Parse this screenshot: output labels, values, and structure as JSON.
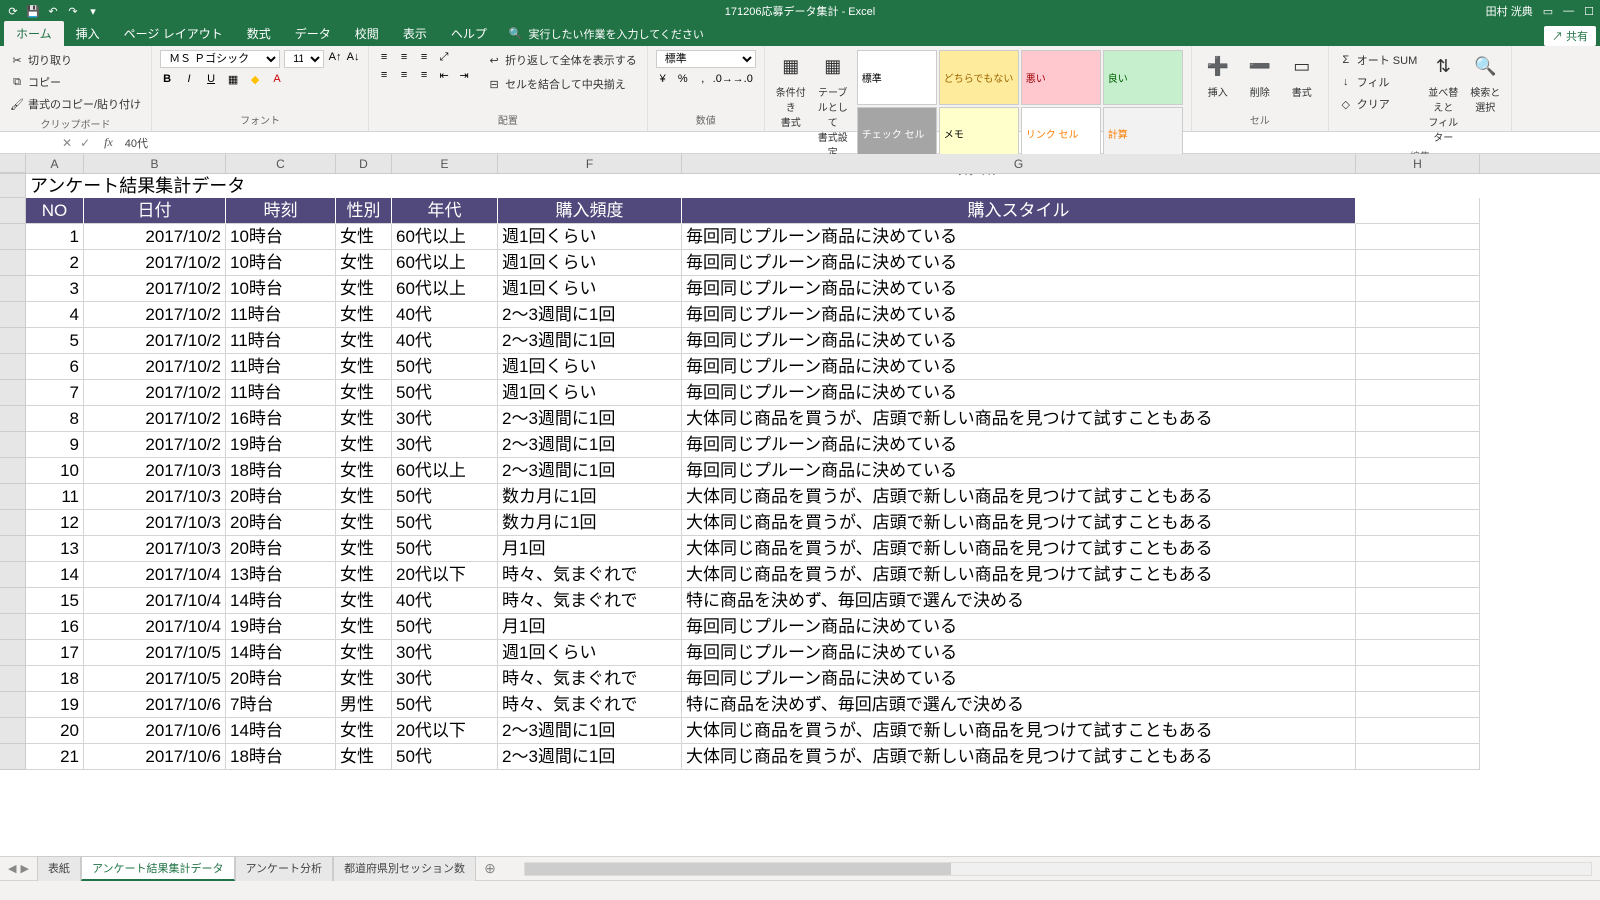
{
  "title": "171206応募データ集計 - Excel",
  "user": "田村 洸典",
  "qat": [
    "autosave",
    "save",
    "undo",
    "redo",
    "touch"
  ],
  "tabs": [
    "ホーム",
    "挿入",
    "ページ レイアウト",
    "数式",
    "データ",
    "校閲",
    "表示",
    "ヘルプ"
  ],
  "active_tab": 0,
  "tell_me": "実行したい作業を入力してください",
  "share": "共有",
  "ribbon": {
    "clipboard": {
      "cut": "切り取り",
      "copy": "コピー",
      "paste": "書式のコピー/貼り付け",
      "label": "クリップボード"
    },
    "font": {
      "name": "ＭＳ Ｐゴシック",
      "size": "11",
      "label": "フォント"
    },
    "align": {
      "wrap": "折り返して全体を表示する",
      "merge": "セルを結合して中央揃え",
      "label": "配置"
    },
    "number": {
      "format": "標準",
      "label": "数値"
    },
    "styles": {
      "cond": "条件付き\n書式",
      "table": "テーブルとして\n書式設定",
      "cells": [
        {
          "t": "標準",
          "bg": "#ffffff",
          "c": "#000"
        },
        {
          "t": "どちらでもない",
          "bg": "#ffeb9c",
          "c": "#9c6500"
        },
        {
          "t": "悪い",
          "bg": "#ffc7ce",
          "c": "#9c0006"
        },
        {
          "t": "良い",
          "bg": "#c6efce",
          "c": "#006100"
        },
        {
          "t": "チェック セル",
          "bg": "#a5a5a5",
          "c": "#fff"
        },
        {
          "t": "メモ",
          "bg": "#ffffcc",
          "c": "#000"
        },
        {
          "t": "リンク セル",
          "bg": "#ffffff",
          "c": "#ff8001"
        },
        {
          "t": "計算",
          "bg": "#f2f2f2",
          "c": "#fa7d00"
        }
      ],
      "label": "スタイル"
    },
    "cells": {
      "insert": "挿入",
      "delete": "削除",
      "format": "書式",
      "label": "セル"
    },
    "editing": {
      "sum": "オート SUM",
      "fill": "フィル",
      "clear": "クリア",
      "sort": "並べ替えと\nフィルター",
      "find": "検索と\n選択",
      "label": "編集"
    }
  },
  "name_box": "",
  "formula": "40代",
  "cols": [
    "A",
    "B",
    "C",
    "D",
    "E",
    "F",
    "G",
    "H"
  ],
  "sheet_title": "アンケート結果集計データ",
  "headers": [
    "NO",
    "日付",
    "時刻",
    "性別",
    "年代",
    "購入頻度",
    "購入スタイル"
  ],
  "rows": [
    {
      "n": 1,
      "d": [
        1,
        "2017/10/2",
        "10時台",
        "女性",
        "60代以上",
        "週1回くらい",
        "毎回同じプルーン商品に決めている"
      ]
    },
    {
      "n": 2,
      "d": [
        2,
        "2017/10/2",
        "10時台",
        "女性",
        "60代以上",
        "週1回くらい",
        "毎回同じプルーン商品に決めている"
      ]
    },
    {
      "n": 3,
      "d": [
        3,
        "2017/10/2",
        "10時台",
        "女性",
        "60代以上",
        "週1回くらい",
        "毎回同じプルーン商品に決めている"
      ]
    },
    {
      "n": 4,
      "d": [
        4,
        "2017/10/2",
        "11時台",
        "女性",
        "40代",
        "2～3週間に1回",
        "毎回同じプルーン商品に決めている"
      ]
    },
    {
      "n": 5,
      "d": [
        5,
        "2017/10/2",
        "11時台",
        "女性",
        "40代",
        "2～3週間に1回",
        "毎回同じプルーン商品に決めている"
      ]
    },
    {
      "n": 6,
      "d": [
        6,
        "2017/10/2",
        "11時台",
        "女性",
        "50代",
        "週1回くらい",
        "毎回同じプルーン商品に決めている"
      ]
    },
    {
      "n": 7,
      "d": [
        7,
        "2017/10/2",
        "11時台",
        "女性",
        "50代",
        "週1回くらい",
        "毎回同じプルーン商品に決めている"
      ]
    },
    {
      "n": 8,
      "d": [
        8,
        "2017/10/2",
        "16時台",
        "女性",
        "30代",
        "2～3週間に1回",
        "大体同じ商品を買うが、店頭で新しい商品を見つけて試すこともある"
      ]
    },
    {
      "n": 9,
      "d": [
        9,
        "2017/10/2",
        "19時台",
        "女性",
        "30代",
        "2～3週間に1回",
        "毎回同じプルーン商品に決めている"
      ]
    },
    {
      "n": 10,
      "d": [
        10,
        "2017/10/3",
        "18時台",
        "女性",
        "60代以上",
        "2～3週間に1回",
        "毎回同じプルーン商品に決めている"
      ]
    },
    {
      "n": 11,
      "d": [
        11,
        "2017/10/3",
        "20時台",
        "女性",
        "50代",
        "数カ月に1回",
        "大体同じ商品を買うが、店頭で新しい商品を見つけて試すこともある"
      ]
    },
    {
      "n": 12,
      "d": [
        12,
        "2017/10/3",
        "20時台",
        "女性",
        "50代",
        "数カ月に1回",
        "大体同じ商品を買うが、店頭で新しい商品を見つけて試すこともある"
      ]
    },
    {
      "n": 13,
      "d": [
        13,
        "2017/10/3",
        "20時台",
        "女性",
        "50代",
        "月1回",
        "大体同じ商品を買うが、店頭で新しい商品を見つけて試すこともある"
      ]
    },
    {
      "n": 14,
      "d": [
        14,
        "2017/10/4",
        "13時台",
        "女性",
        "20代以下",
        "時々、気まぐれで",
        "大体同じ商品を買うが、店頭で新しい商品を見つけて試すこともある"
      ]
    },
    {
      "n": 15,
      "d": [
        15,
        "2017/10/4",
        "14時台",
        "女性",
        "40代",
        "時々、気まぐれで",
        "特に商品を決めず、毎回店頭で選んで決める"
      ]
    },
    {
      "n": 16,
      "d": [
        16,
        "2017/10/4",
        "19時台",
        "女性",
        "50代",
        "月1回",
        "毎回同じプルーン商品に決めている"
      ]
    },
    {
      "n": 17,
      "d": [
        17,
        "2017/10/5",
        "14時台",
        "女性",
        "30代",
        "週1回くらい",
        "毎回同じプルーン商品に決めている"
      ]
    },
    {
      "n": 18,
      "d": [
        18,
        "2017/10/5",
        "20時台",
        "女性",
        "30代",
        "時々、気まぐれで",
        "毎回同じプルーン商品に決めている"
      ]
    },
    {
      "n": 19,
      "d": [
        19,
        "2017/10/6",
        "7時台",
        "男性",
        "50代",
        "時々、気まぐれで",
        "特に商品を決めず、毎回店頭で選んで決める"
      ]
    },
    {
      "n": 20,
      "d": [
        20,
        "2017/10/6",
        "14時台",
        "女性",
        "20代以下",
        "2～3週間に1回",
        "大体同じ商品を買うが、店頭で新しい商品を見つけて試すこともある"
      ]
    },
    {
      "n": 21,
      "d": [
        21,
        "2017/10/6",
        "18時台",
        "女性",
        "50代",
        "2～3週間に1回",
        "大体同じ商品を買うが、店頭で新しい商品を見つけて試すこともある"
      ]
    }
  ],
  "sheets": [
    "表紙",
    "アンケート結果集計データ",
    "アンケート分析",
    "都道府県別セッション数"
  ],
  "active_sheet": 1,
  "status_ready": ""
}
